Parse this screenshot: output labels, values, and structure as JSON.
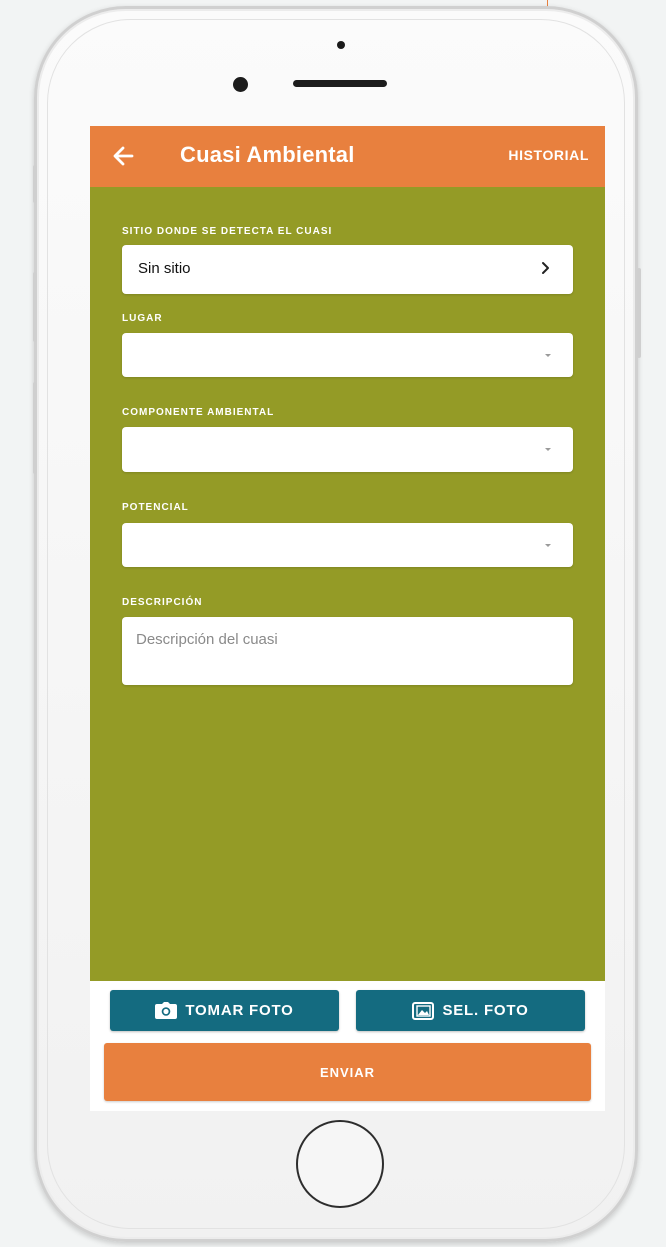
{
  "appbar": {
    "title": "Cuasi Ambiental",
    "action_label": "HISTORIAL",
    "back_icon": "arrow-left-icon",
    "color": "#e8803e"
  },
  "form": {
    "background": "#949b26",
    "fields": [
      {
        "label": "SITIO DONDE SE DETECTA EL CUASI",
        "value": "Sin sitio",
        "type": "navigation",
        "icon": "chevron-right-icon"
      },
      {
        "label": "LUGAR",
        "value": "",
        "type": "select",
        "icon": "dropdown-caret-icon"
      },
      {
        "label": "COMPONENTE AMBIENTAL",
        "value": "",
        "type": "select",
        "icon": "dropdown-caret-icon"
      },
      {
        "label": "POTENCIAL",
        "value": "",
        "type": "select",
        "icon": "dropdown-caret-icon"
      },
      {
        "label": "DESCRIPCIÓN",
        "value": "",
        "placeholder": "Descripción del cuasi",
        "type": "textarea"
      }
    ]
  },
  "actions": {
    "take_photo": {
      "label": "TOMAR FOTO",
      "icon": "camera-icon"
    },
    "select_photo": {
      "label": "SEL. FOTO",
      "icon": "image-gallery-icon"
    },
    "send": {
      "label": "ENVIAR"
    },
    "photo_button_color": "#146b80",
    "send_button_color": "#e8803e"
  }
}
